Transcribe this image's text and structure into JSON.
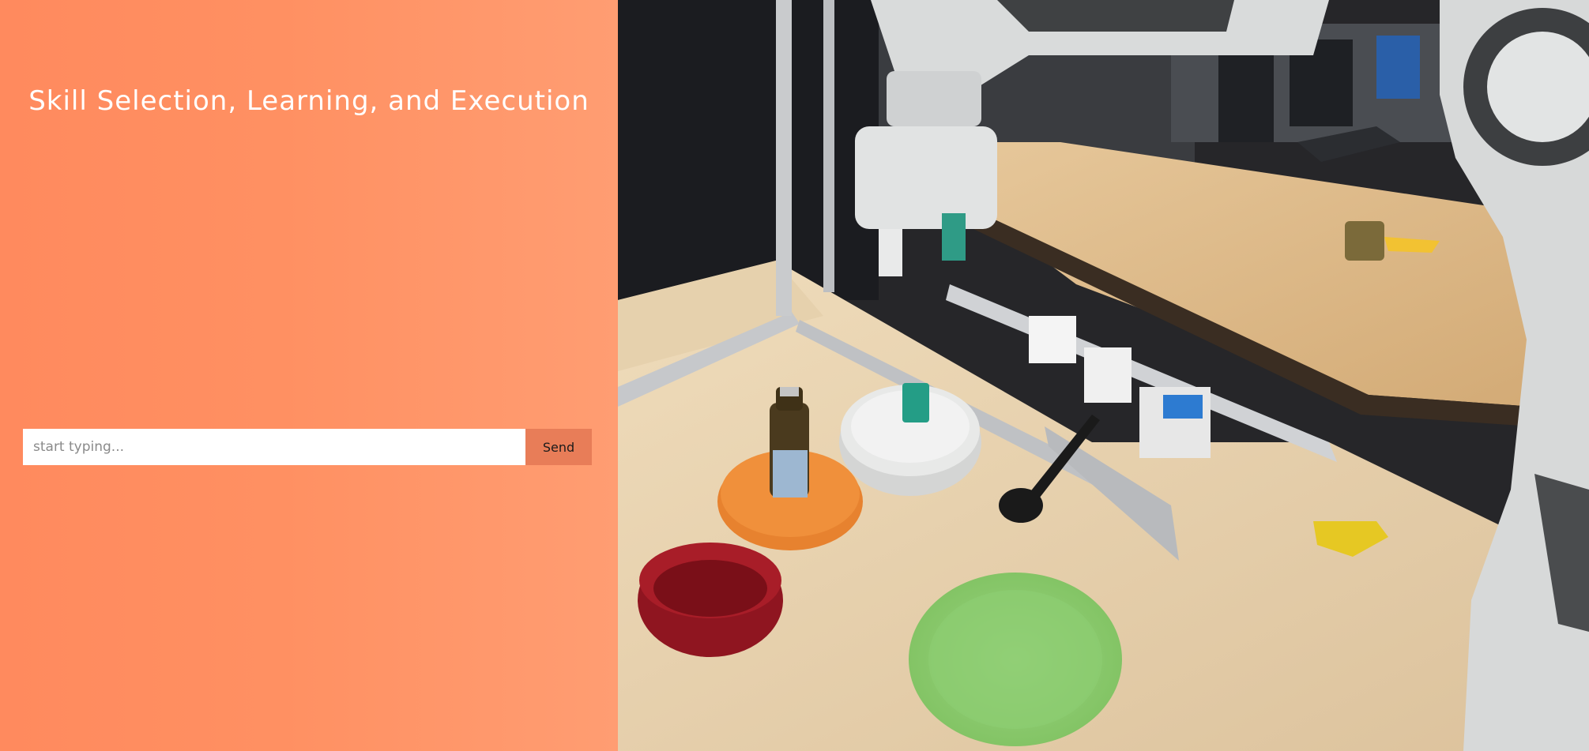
{
  "panel": {
    "title": "Skill Selection, Learning, and Execution"
  },
  "chat": {
    "placeholder": "start typing...",
    "value": "",
    "send_label": "Send"
  },
  "colors": {
    "panel_gradient_start": "#ff8a5e",
    "panel_gradient_end": "#ff9d72",
    "send_button": "#e87d58",
    "input_background": "#ffffff"
  }
}
